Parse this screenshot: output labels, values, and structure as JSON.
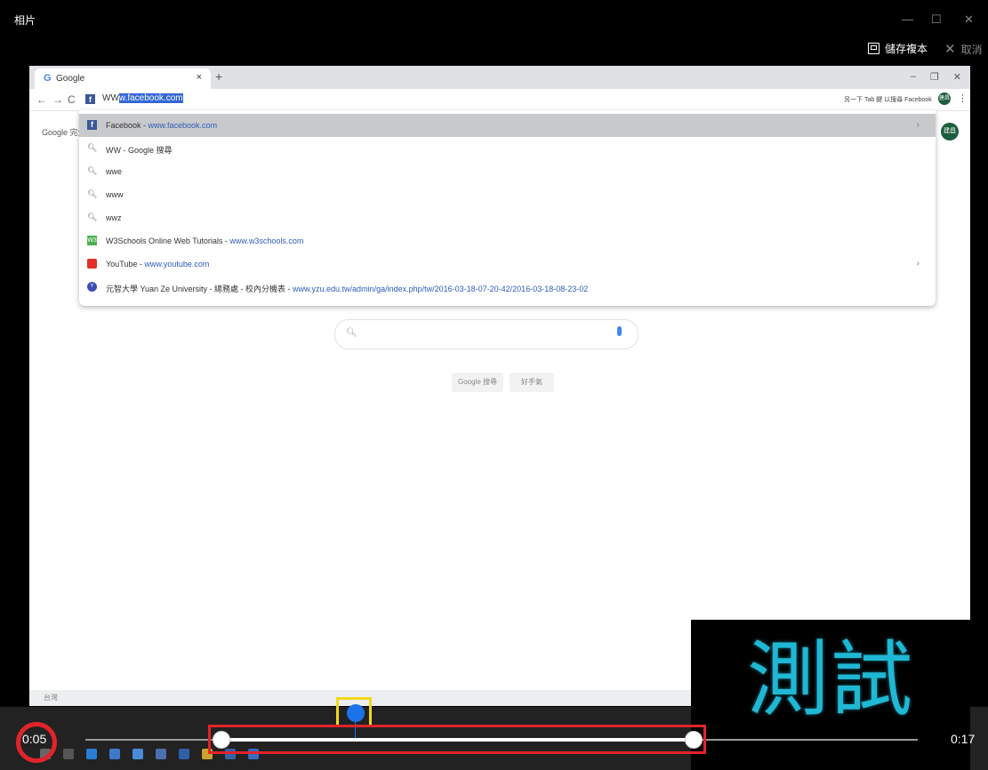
{
  "app": {
    "title": "相片",
    "save_copy": "儲存複本",
    "cancel": "取消",
    "win_min": "—",
    "win_max": "☐",
    "win_close": "✕"
  },
  "browser": {
    "tab_title": "Google",
    "tab_close": "×",
    "new_tab": "+",
    "omnibox_prefix": "WW",
    "omnibox_selected": "w.facebook.com",
    "bookmarks_text": "另一下 Tab 鍵 以搜尋 Facebook",
    "avatar_text": "建昌",
    "sidebar_text": "Google 完全…",
    "controls": [
      "–",
      "❐",
      "✕"
    ]
  },
  "suggestions": [
    {
      "icon": "facebook-icon",
      "text": "Facebook - ",
      "url": "www.facebook.com",
      "arrow": "›",
      "highlight": true
    },
    {
      "icon": "search-icon",
      "text": "WW - Google 搜尋",
      "url": "",
      "arrow": ""
    },
    {
      "icon": "search-icon",
      "text": "wwe",
      "url": "",
      "arrow": ""
    },
    {
      "icon": "search-icon",
      "text": "www",
      "url": "",
      "arrow": ""
    },
    {
      "icon": "search-icon",
      "text": "wwz",
      "url": "",
      "arrow": ""
    },
    {
      "icon": "w3schools-icon",
      "text": "W3Schools Online Web Tutorials - ",
      "url": "www.w3schools.com",
      "arrow": ""
    },
    {
      "icon": "youtube-icon",
      "text": "YouTube - ",
      "url": "www.youtube.com",
      "arrow": "›"
    },
    {
      "icon": "yzu-icon",
      "text": "元智大學 Yuan Ze University - 總務處 - 校內分機表 - ",
      "url": "www.yzu.edu.tw/admin/ga/index.php/tw/2016-03-18-07-20-42/2016-03-18-08-23-02",
      "arrow": ""
    }
  ],
  "google": {
    "search_btn": "Google 搜尋",
    "lucky_btn": "好手氣"
  },
  "frame_bottom": "台灣",
  "overlay_text": "測試",
  "playback": {
    "current": "0:05",
    "end": "0:17",
    "trim_start": 0.16,
    "trim_end": 0.73,
    "position": 0.32
  },
  "colors": {
    "accent": "#1a73e8",
    "highlight_yellow": "#f2d81b",
    "highlight_red": "#e0242a",
    "overlay_text": "#1fb8d4"
  }
}
